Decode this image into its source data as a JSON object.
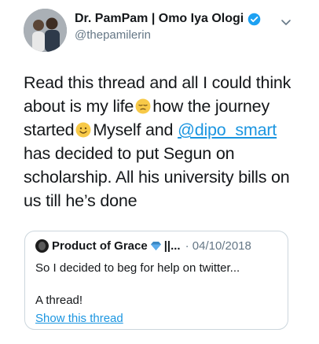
{
  "author": {
    "display_name": "Dr. PamPam | Omo Iya Ologi",
    "handle": "@thepamilerin",
    "avatar_icon": "user-photo-avatar",
    "verified_icon": "verified-badge-icon",
    "verified_color": "#1da1f2"
  },
  "menu_icon": "chevron-down-icon",
  "tweet": {
    "line1": "Read this thread and all I could think",
    "line2_a": "about is my life",
    "line2_b": "how the journey",
    "line3_a": "started",
    "line3_b": "Myself and",
    "mention": "@dipo_smart",
    "line4": "has decided to put Segun on",
    "line5": "scholarship. All his university bills on",
    "line6": "us till he’s done",
    "emoji1_icon": "pensive-face-emoji",
    "emoji2_icon": "smiling-face-emoji"
  },
  "quoted_tweet": {
    "author_name": "Product of Grace",
    "name_icon": "blue-diamond-emoji",
    "name_tail": "||...",
    "date": "· 04/10/2018",
    "text_line1": "So I decided to beg for help on twitter...",
    "text_line2": "A thread!",
    "link_text": "Show this thread"
  },
  "colors": {
    "text": "#14171a",
    "secondary": "#657786",
    "link": "#1b95e0",
    "border": "#ccd6dd"
  }
}
